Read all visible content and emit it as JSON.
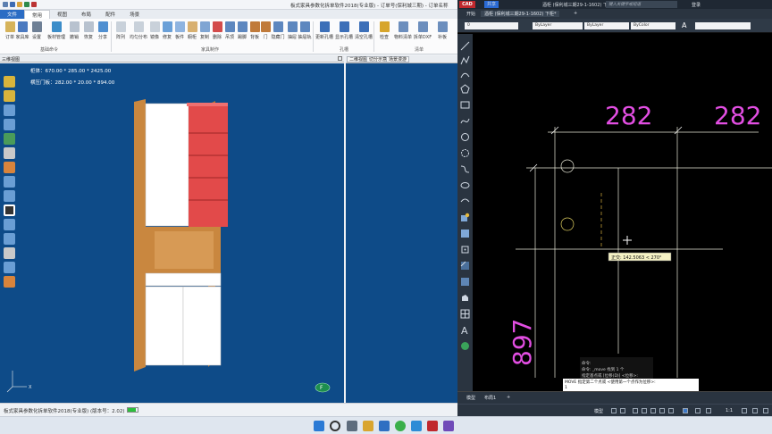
{
  "left_app": {
    "title": "板式家具参数化拆单软件2018(专业版) - 订单号(保利城三期) - 订单名称",
    "menu_tabs": [
      "文件",
      "常用",
      "视图",
      "布局",
      "配件",
      "场景"
    ],
    "active_tab": "常用",
    "ribbon": {
      "buttons": [
        "订单",
        "家具库",
        "设置",
        "板材管理",
        "撤销",
        "恢复",
        "分享",
        "阵列",
        "均匀分布",
        "镜像",
        "修复",
        "板件",
        "橱柜",
        "复制",
        "删除",
        "吊顶",
        "踢脚",
        "背板",
        "门",
        "隐藏门",
        "抽屉",
        "抽屉轨",
        "更新孔槽",
        "显示孔槽",
        "清空孔槽",
        "检查",
        "物料清单",
        "拆单DXF",
        "补板"
      ],
      "groups": [
        "基础命令",
        "家具制作",
        "孔槽",
        "清单"
      ]
    },
    "view_left_title": "三维视图",
    "view_right_tabs": [
      "二维视图",
      "切分示意",
      "场景漫游"
    ],
    "dim_info_1": "柜体：670.00 * 285.00 * 2425.00",
    "dim_info_2": "横压门板：282.00 * 20.00 * 894.00",
    "status_text": "板式家具参数化拆单软件2018(专业版)   (版本号：2.02)",
    "status_progress": 0.8
  },
  "cad": {
    "logo": "CAD",
    "share": "共享",
    "window_title": "酒柜 (保利城三期29-1-1602) 下柜*",
    "search_placeholder": "键入关键字或短语",
    "login": "登录",
    "tabs": [
      "开始",
      "酒柜 (保利城三期29-1-1602) 下柜*",
      "+"
    ],
    "layer_value": "0",
    "props": [
      "ByLayer",
      "ByLayer",
      "ByColor"
    ],
    "dimensions": [
      "282",
      "282",
      "897"
    ],
    "tooltip": "正交: 142.5063 < 270°",
    "command_history": [
      "命令:",
      "命令: _move 找到 1 个",
      "指定基点或 [位移(D)] <位移>:"
    ],
    "command_prompt": "MOVE 指定第二个点或 <使用第一个点作为位移>:",
    "command_input": "1",
    "layout_tabs": [
      "模型",
      "布局1",
      "+"
    ],
    "status_model": "模型",
    "scale": "1:1"
  },
  "colors": {
    "viewport_bg": "#0e4b88",
    "cabinet_red": "#e24a4a",
    "cabinet_wood": "#c9873f",
    "cad_dim_magenta": "#e24ee2"
  }
}
